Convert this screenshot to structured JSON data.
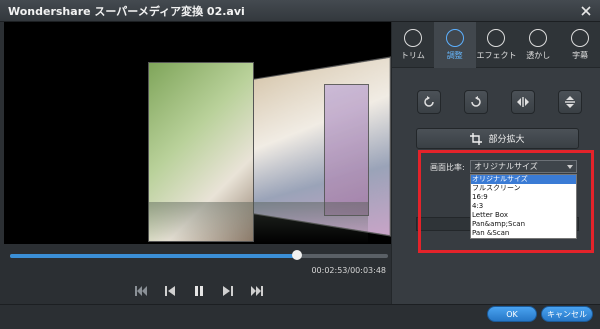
{
  "window": {
    "title": "Wondershare スーパーメディア変換 02.avi"
  },
  "tabs": [
    {
      "label": "トリム",
      "icon": "scissors-icon",
      "active": false
    },
    {
      "label": "調整",
      "icon": "adjust-icon",
      "active": true
    },
    {
      "label": "エフェクト",
      "icon": "effect-icon",
      "active": false
    },
    {
      "label": "透かし",
      "icon": "watermark-icon",
      "active": false
    },
    {
      "label": "字幕",
      "icon": "subtitle-icon",
      "active": false
    }
  ],
  "tools": [
    "rotate-left-icon",
    "rotate-right-icon",
    "flip-horizontal-icon",
    "flip-vertical-icon"
  ],
  "zoom": {
    "label": "部分拡大"
  },
  "aspect": {
    "label": "画面比率:",
    "selected": "オリジナルサイズ",
    "options": [
      "オリジナルサイズ",
      "フルスクリーン",
      "16:9",
      "4:3",
      "Letter Box",
      "Pan&amp;Scan",
      "Pan &Scan"
    ]
  },
  "player": {
    "timecode": "00:02:53/00:03:48",
    "progress": 0.76
  },
  "buttons": {
    "ok": "OK",
    "cancel": "キャンセル"
  },
  "colors": {
    "accent": "#3b8fd6",
    "highlight": "#e4232a"
  }
}
